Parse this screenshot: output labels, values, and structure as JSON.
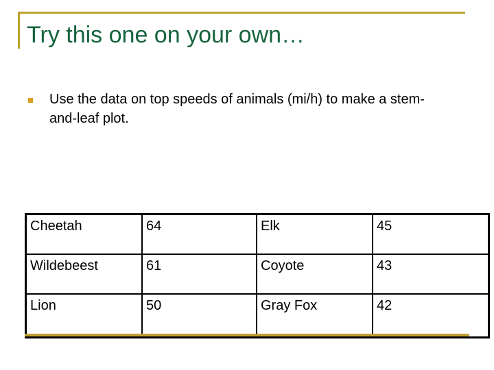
{
  "slide": {
    "title": "Try this one on your own…",
    "accent_color": "#bfa02e",
    "title_color": "#16633c",
    "bullet_color": "#d79f1a",
    "text_color": "#000000",
    "background_color": "#ffffff"
  },
  "body": {
    "bullets": [
      "Use the data on top speeds of animals (mi/h) to make a stem-and-leaf plot."
    ]
  },
  "table": {
    "columns": 4,
    "rows": [
      {
        "name_a": "Cheetah",
        "value_a": "64",
        "name_b": "Elk",
        "value_b": "45"
      },
      {
        "name_a": "Wildebeest",
        "value_a": "61",
        "name_b": "Coyote",
        "value_b": "43"
      },
      {
        "name_a": "Lion",
        "value_a": "50",
        "name_b": "Gray Fox",
        "value_b": "42"
      }
    ]
  }
}
